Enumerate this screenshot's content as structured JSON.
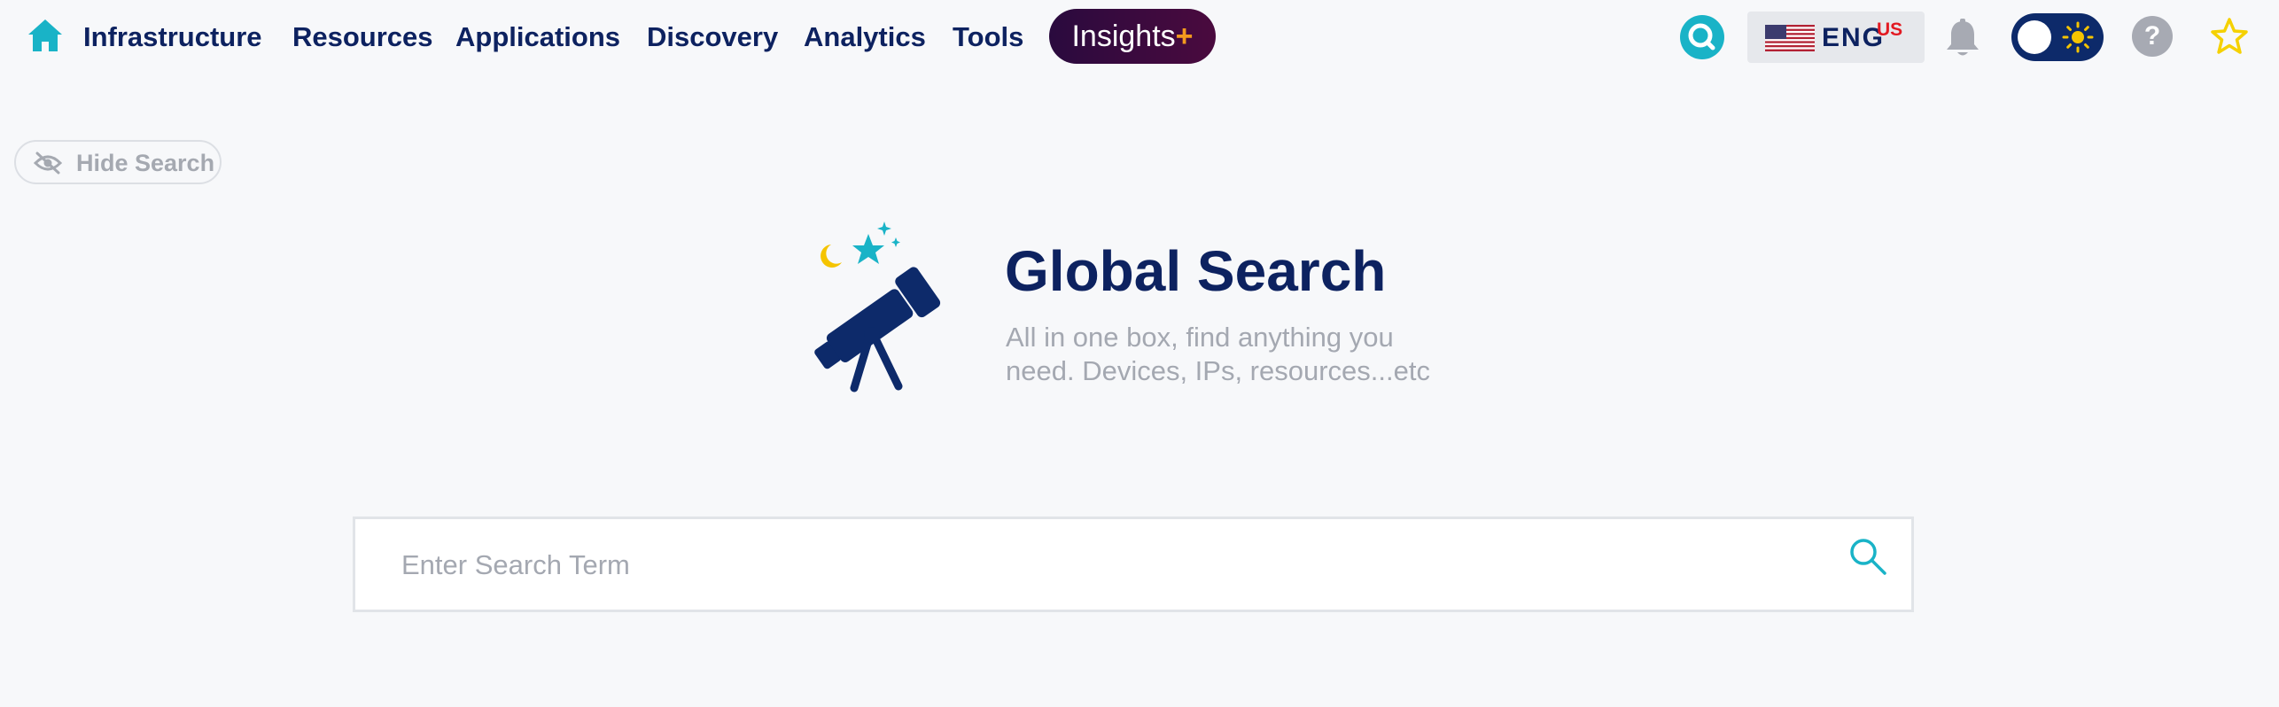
{
  "nav": {
    "items": [
      {
        "label": "Infrastructure"
      },
      {
        "label": "Resources"
      },
      {
        "label": "Applications"
      },
      {
        "label": "Discovery"
      },
      {
        "label": "Analytics"
      },
      {
        "label": "Tools"
      }
    ],
    "insights": {
      "label": "Insights",
      "suffix": "+"
    },
    "language": {
      "code": "ENG",
      "region": "US"
    },
    "help_label": "?",
    "icons": [
      "home-icon",
      "search-icon",
      "us-flag-icon",
      "bell-icon",
      "theme-toggle",
      "sun-icon",
      "help-icon",
      "star-icon"
    ]
  },
  "hide_search": {
    "label": "Hide Search",
    "icon": "eye-slash-icon"
  },
  "hero": {
    "title": "Global Search",
    "subtitle": "All in one box, find anything you need. Devices, IPs, resources...etc",
    "icon": "telescope-icon"
  },
  "search": {
    "placeholder": "Enter Search Term",
    "value": ""
  },
  "colors": {
    "navy": "#0d2260",
    "teal": "#19b3c7",
    "insights_bg": "#2a0a3e",
    "insights_plus": "#f39a1e",
    "muted_text": "#a4a8b1",
    "star": "#f5d100",
    "moon": "#f5c400",
    "background": "#f7f8fa"
  }
}
